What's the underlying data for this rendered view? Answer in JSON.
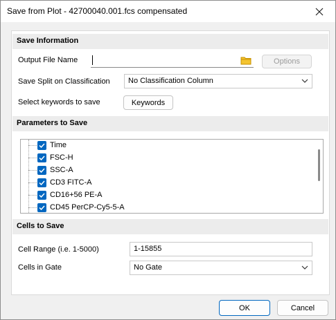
{
  "window": {
    "title": "Save from Plot - 42700040.001.fcs compensated"
  },
  "save_information": {
    "heading": "Save Information",
    "output_file_name_label": "Output File Name",
    "output_file_name_value": "",
    "options_label": "Options",
    "save_split_label": "Save Split on Classification",
    "save_split_value": "No Classification Column",
    "keywords_label": "Select keywords to save",
    "keywords_button": "Keywords"
  },
  "parameters": {
    "heading": "Parameters to Save",
    "items": [
      {
        "label": "Time",
        "checked": true
      },
      {
        "label": "FSC-H",
        "checked": true
      },
      {
        "label": "SSC-A",
        "checked": true
      },
      {
        "label": "CD3 FITC-A",
        "checked": true
      },
      {
        "label": "CD16+56 PE-A",
        "checked": true
      },
      {
        "label": "CD45 PerCP-Cy5-5-A",
        "checked": true
      }
    ]
  },
  "cells": {
    "heading": "Cells to Save",
    "range_label": "Cell Range (i.e. 1-5000)",
    "range_value": "1-15855",
    "gate_label": "Cells in Gate",
    "gate_value": "No Gate"
  },
  "footer": {
    "ok_label": "OK",
    "cancel_label": "Cancel"
  },
  "colors": {
    "accent": "#0067c0",
    "folder": "#e8b400"
  }
}
